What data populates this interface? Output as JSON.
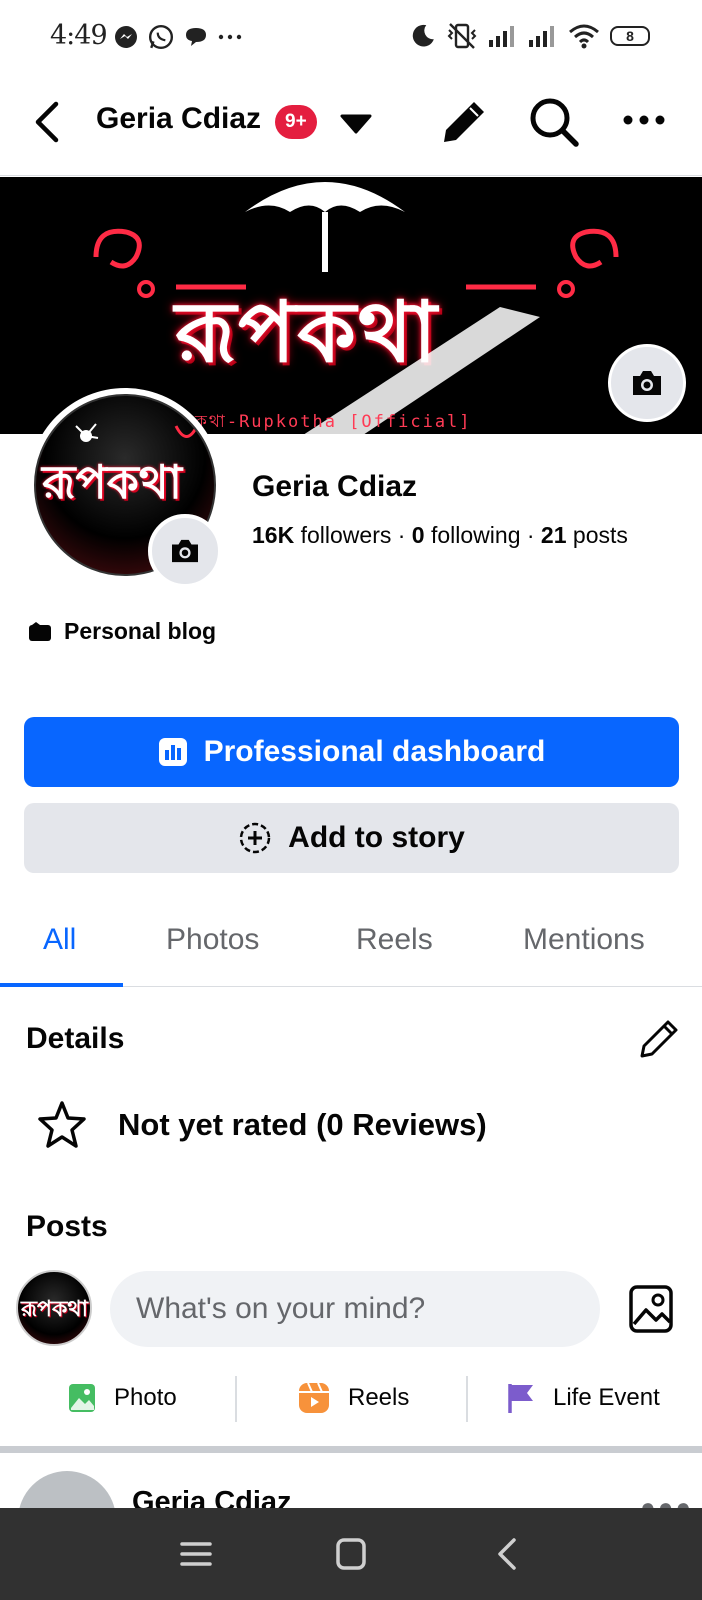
{
  "status_bar": {
    "time": "4:49",
    "left_icons": [
      "messenger-icon",
      "whatsapp-icon",
      "chat-bubble-icon",
      "more-dots-icon"
    ],
    "right_icons": [
      "moon-icon",
      "mute-vibrate-icon",
      "signal-icon",
      "signal-icon",
      "wifi-icon",
      "battery-icon"
    ],
    "battery_level": "8"
  },
  "header": {
    "title": "Geria Cdiaz",
    "badge": "9+"
  },
  "cover": {
    "brand_text": "রূপকথা",
    "subtitle": "কথা-Rupkotha [Official]"
  },
  "avatar": {
    "brand_text": "রূপকথা"
  },
  "profile": {
    "name": "Geria Cdiaz",
    "followers_count": "16K",
    "followers_label": " followers · ",
    "following_count": "0",
    "following_label": " following · ",
    "posts_count": "21",
    "posts_label": " posts",
    "category": "Personal blog"
  },
  "buttons": {
    "dashboard": "Professional dashboard",
    "add_story": "Add to story"
  },
  "tabs": [
    {
      "label": "All"
    },
    {
      "label": "Photos"
    },
    {
      "label": "Reels"
    },
    {
      "label": "Mentions"
    }
  ],
  "details": {
    "title": "Details",
    "rating": "Not yet rated (0 Reviews)"
  },
  "posts": {
    "title": "Posts",
    "composer_placeholder": "What's on your mind?",
    "quick_actions": [
      {
        "label": "Photo",
        "icon": "photo-icon",
        "color": "#45bd62"
      },
      {
        "label": "Reels",
        "icon": "reels-icon",
        "color": "#f7923b"
      },
      {
        "label": "Life Event",
        "icon": "flag-icon",
        "color": "#7c5ccc"
      }
    ],
    "peek_author": "Geria Cdiaz"
  },
  "colors": {
    "accent": "#0866ff",
    "badge": "#e41e3f",
    "secondary_button": "#e4e6eb"
  }
}
